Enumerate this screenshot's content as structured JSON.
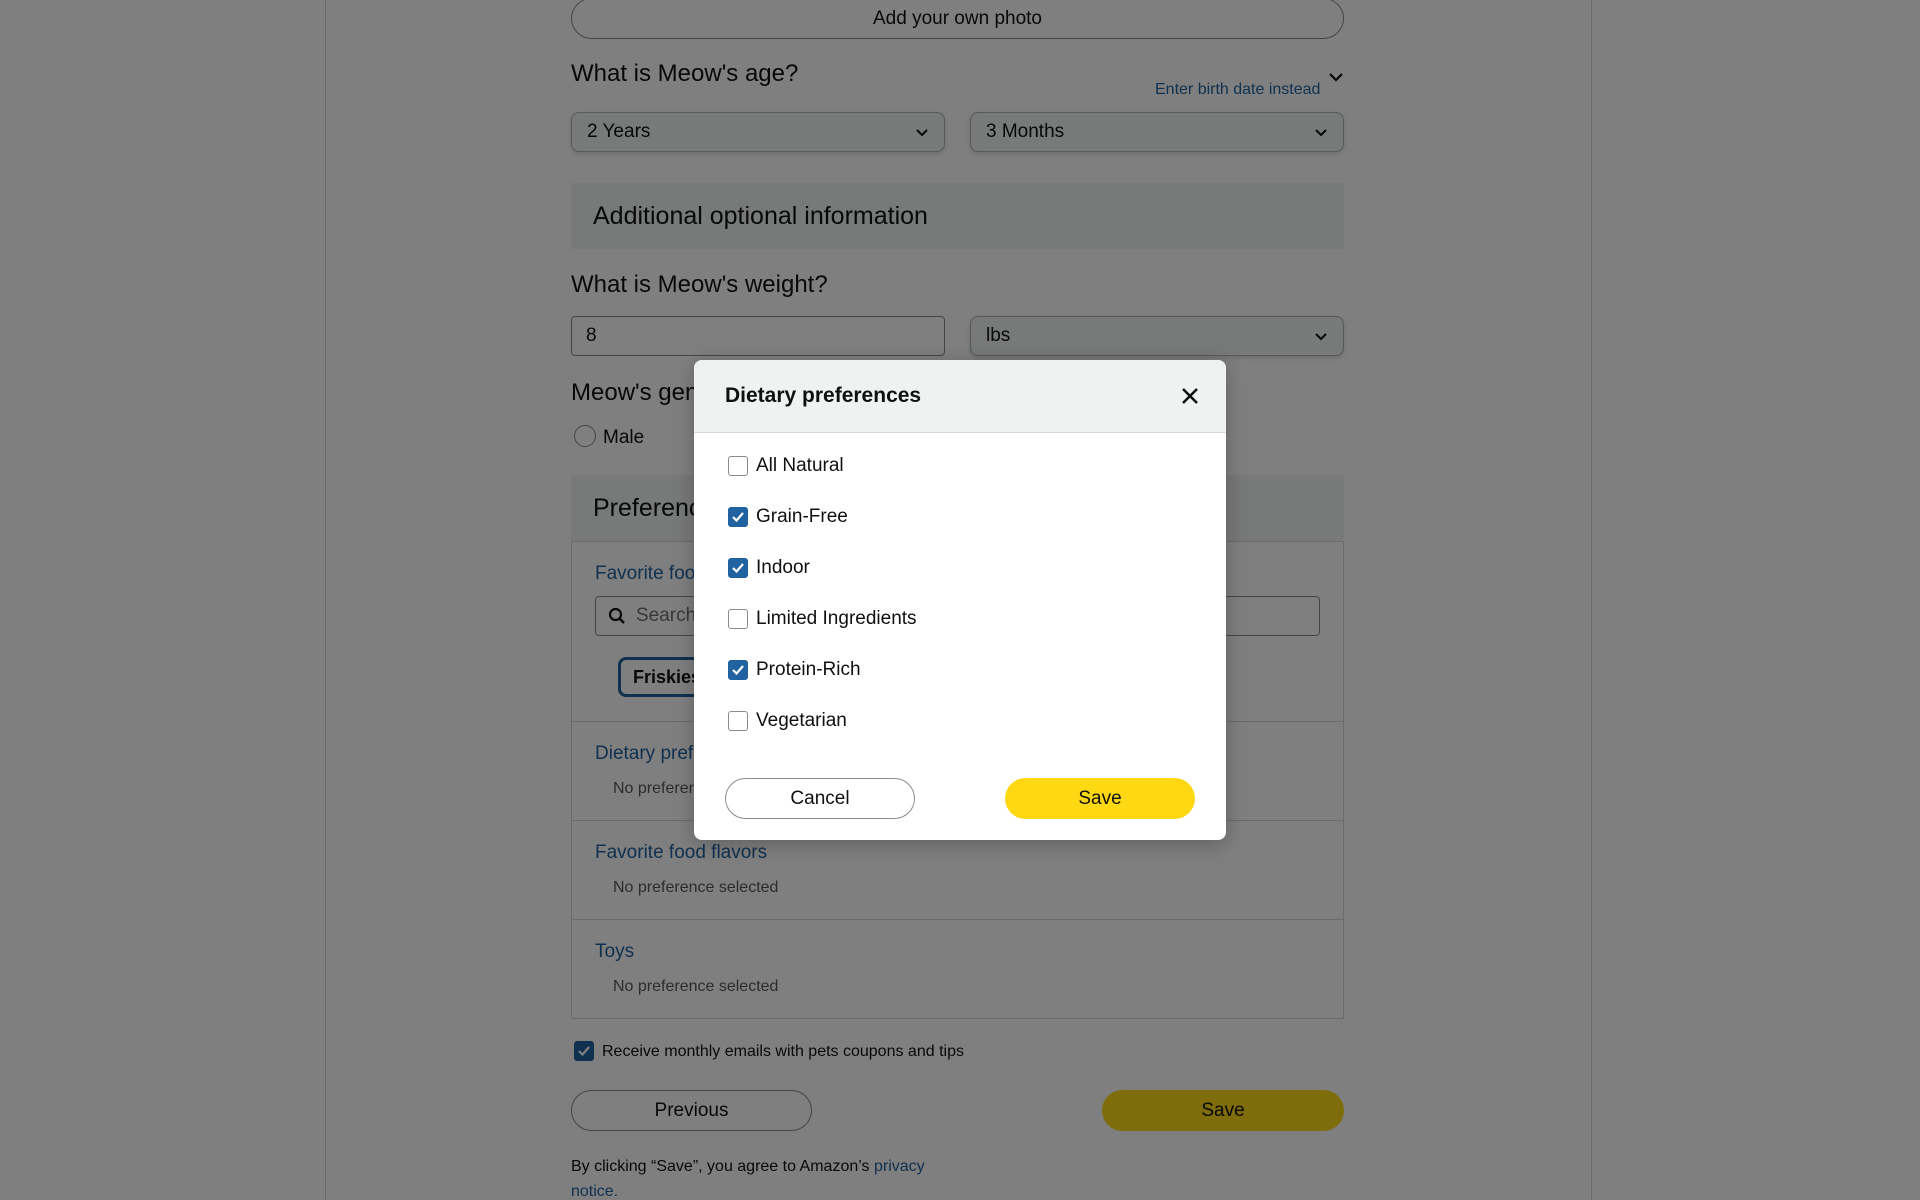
{
  "photo": {
    "add_label": "Add your own photo"
  },
  "age": {
    "question": "What is Meow's age?",
    "birthdate_link": "Enter birth date instead",
    "years_value": "2 Years",
    "months_value": "3 Months"
  },
  "additional": {
    "heading": "Additional optional information"
  },
  "weight": {
    "question": "What is Meow's weight?",
    "value": "8",
    "unit": "lbs"
  },
  "gender": {
    "question_partial": "Meow's gen",
    "male_label": "Male"
  },
  "preferences": {
    "heading_partial": "Preferenc",
    "favorite_foods_partial": "Favorite foo",
    "search_partial": "Search",
    "chip_partial": "Friskies",
    "dietary_partial": "Dietary prefe",
    "dietary_sub_partial": "No preferen",
    "flavors_title": "Favorite food flavors",
    "flavors_sub": "No preference selected",
    "toys_title": "Toys",
    "toys_sub": "No preference selected"
  },
  "emails": {
    "label": "Receive monthly emails with pets coupons and tips",
    "checked": true
  },
  "footer": {
    "previous_label": "Previous",
    "save_label": "Save",
    "notice_text": "By clicking “Save”, you agree to Amazon’s ",
    "notice_link_1": "privacy",
    "notice_link_2": "notice."
  },
  "modal": {
    "title": "Dietary preferences",
    "options": [
      {
        "label": "All Natural",
        "checked": false
      },
      {
        "label": "Grain-Free",
        "checked": true
      },
      {
        "label": "Indoor",
        "checked": true
      },
      {
        "label": "Limited Ingredients",
        "checked": false
      },
      {
        "label": "Protein-Rich",
        "checked": true
      },
      {
        "label": "Vegetarian",
        "checked": false
      }
    ],
    "cancel_label": "Cancel",
    "save_label": "Save"
  },
  "colors": {
    "accent_link": "#2162a1",
    "primary_button": "#ffd814",
    "checkbox_checked": "#2162a1"
  }
}
